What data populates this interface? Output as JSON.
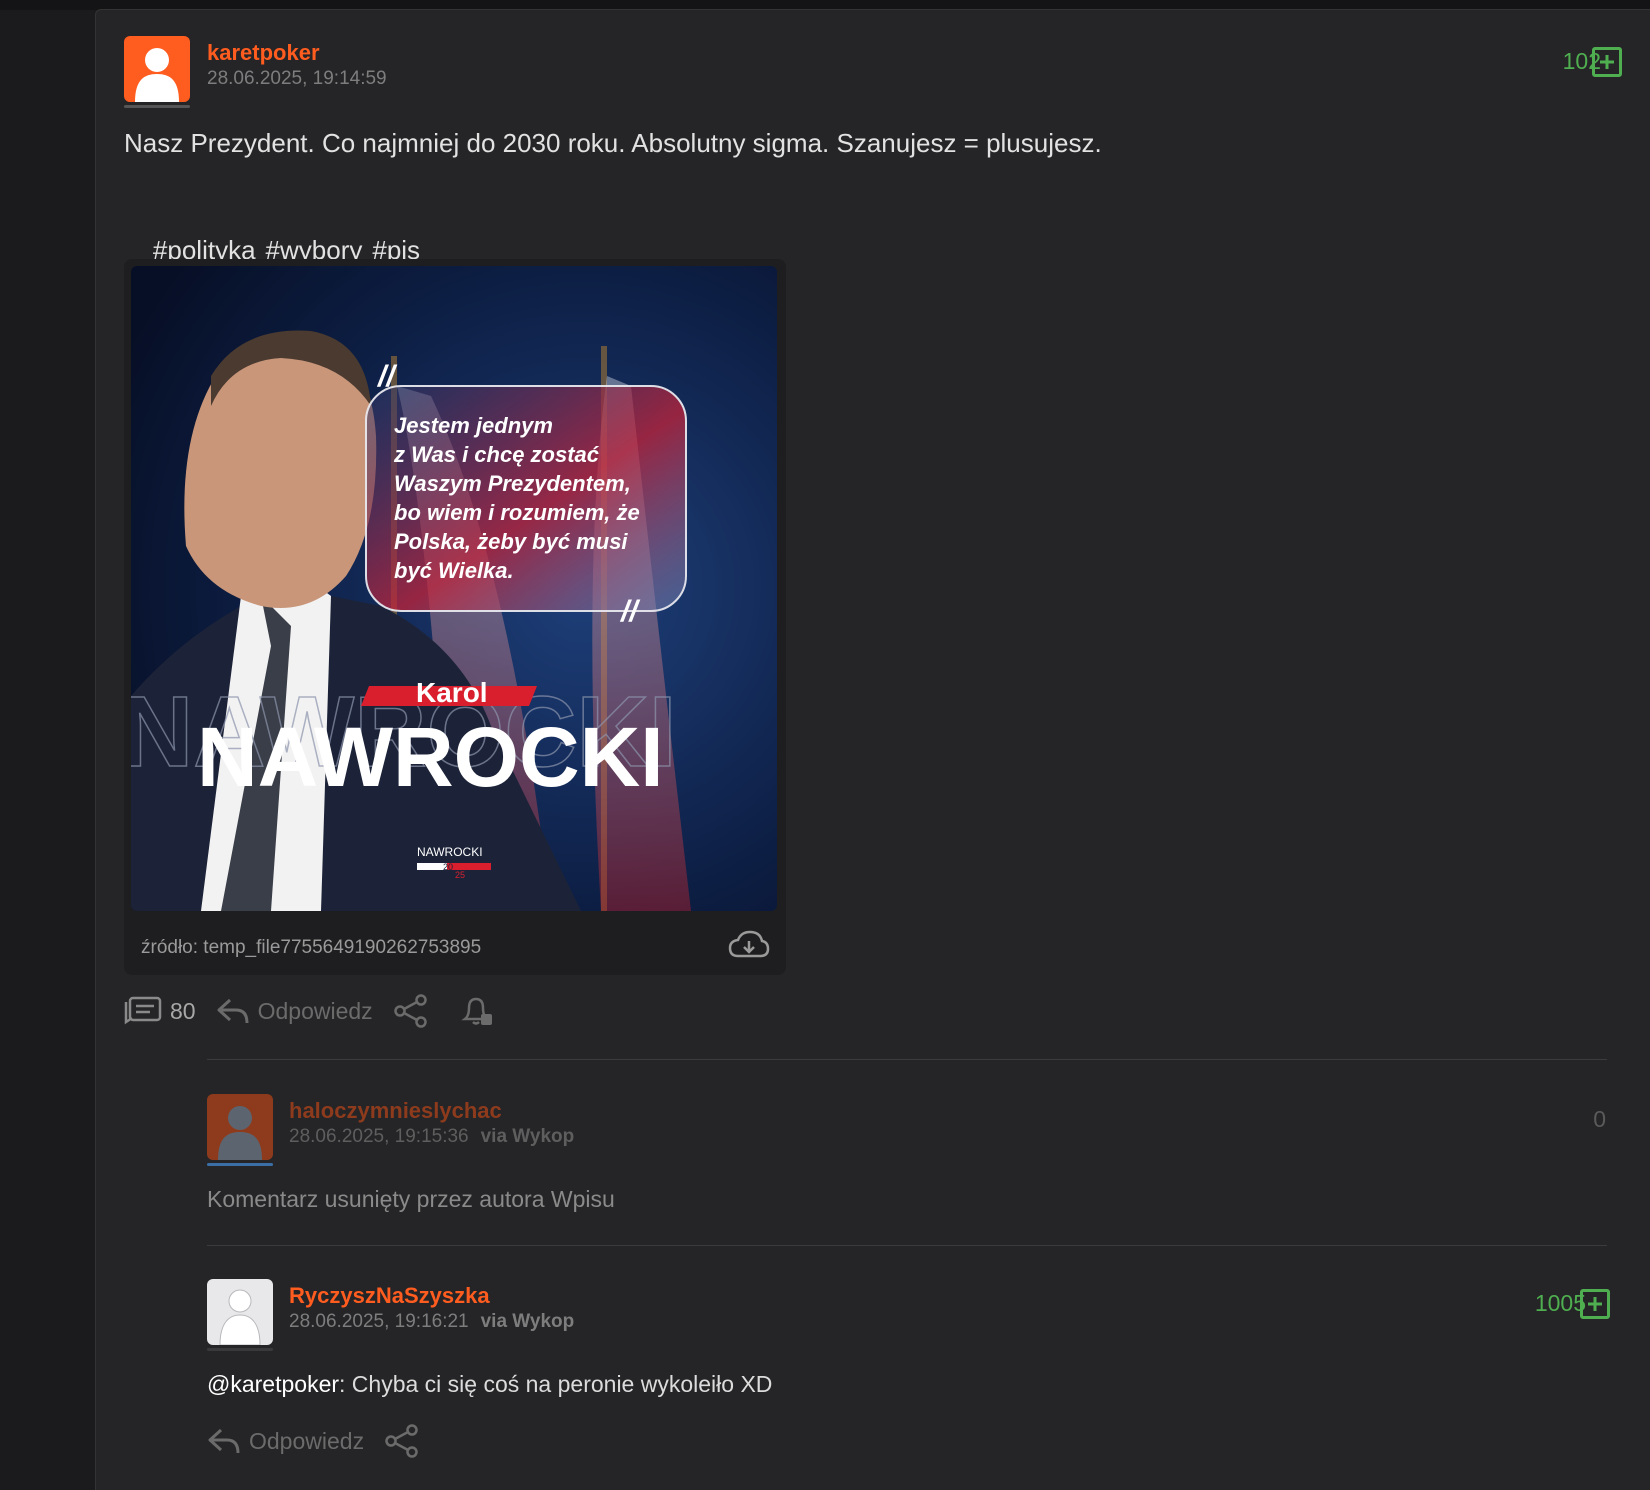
{
  "post": {
    "author": "karetpoker",
    "timestamp": "28.06.2025, 19:14:59",
    "score": "102",
    "text": "Nasz Prezydent. Co najmniej do 2030 roku. Absolutny sigma. Szanujesz = plusujesz.",
    "tags": [
      "#polityka",
      "#wybory",
      "#pis"
    ],
    "image": {
      "quote_lines": [
        "Jestem jednym",
        "z Was i chcę zostać",
        "Waszym Prezydentem,",
        "bo wiem i rozumiem, że",
        "Polska, żeby być musi",
        "być Wielka."
      ],
      "first_name": "Karol",
      "last_name": "NAWROCKI",
      "logo_text": "NAWROCKI",
      "logo_year_a": "20",
      "logo_year_b": "25",
      "source_label": "źródło: temp_file7755649190262753895"
    },
    "actions": {
      "comments_count": "80",
      "reply_label": "Odpowiedz"
    }
  },
  "comments": [
    {
      "author": "haloczymnieslychac",
      "timestamp": "28.06.2025, 19:15:36",
      "via": "via Wykop",
      "score": "0",
      "text": "Komentarz usunięty przez autora Wpisu"
    },
    {
      "author": "RyczyszNaSzyszka",
      "timestamp": "28.06.2025, 19:16:21",
      "via": "via Wykop",
      "score": "1005",
      "mention": "@karetpoker",
      "text": ": Chyba ci się coś na peronie wykoleiło XD",
      "reply_label": "Odpowiedz"
    }
  ],
  "colors": {
    "accent_orange": "#ff5c1f",
    "score_green": "#4fae4f",
    "deleted_author": "#8d3b1c"
  }
}
